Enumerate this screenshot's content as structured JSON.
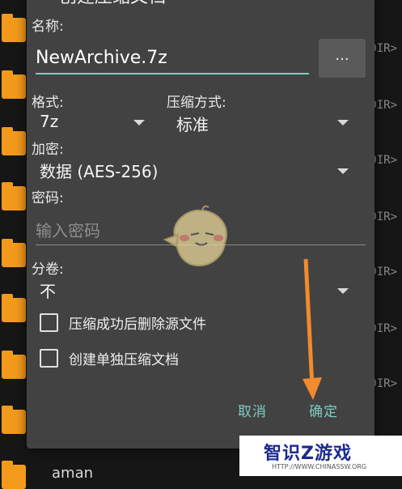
{
  "background": {
    "dir_label": "DIR>",
    "bottom_item": "aman"
  },
  "dialog": {
    "title": "创建压缩文档",
    "name_label": "名称:",
    "name_value": "NewArchive.7z",
    "browse_label": "...",
    "format_label": "格式:",
    "format_value": "7z",
    "method_label": "压缩方式:",
    "method_value": "标准",
    "encryption_label": "加密:",
    "encryption_value": "数据 (AES-256)",
    "password_label": "密码:",
    "password_placeholder": "输入密码",
    "split_label": "分卷:",
    "split_value": "不",
    "checkbox_delete_source": "压缩成功后删除源文件",
    "checkbox_separate_archive": "创建单独压缩文档",
    "cancel_label": "取消",
    "ok_label": "确定"
  },
  "watermark": {
    "text": "智识Z游戏",
    "subtext": "HTTP://WWW.CHINASSW.ORG"
  },
  "colors": {
    "accent": "#80cbc4",
    "dialog_bg": "#424242",
    "folder": "#f39a1b",
    "arrow": "#f28a2e"
  }
}
